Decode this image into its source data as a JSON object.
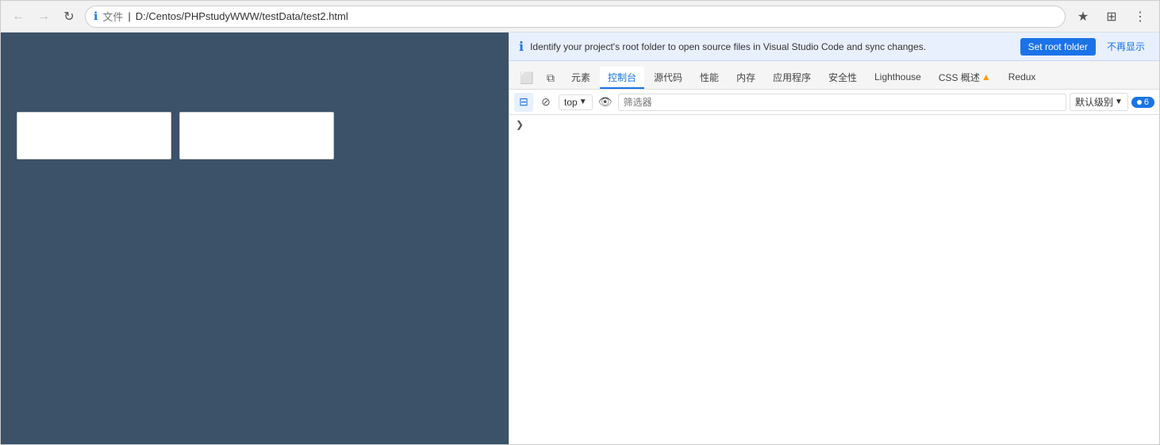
{
  "browser": {
    "back_btn": "←",
    "forward_btn": "→",
    "reload_btn": "↻",
    "file_label": "文件",
    "url": "D:/Centos/PHPstudyWWW/testData/test2.html",
    "star_icon": "★",
    "extensions_icon": "⊞",
    "menu_icon": "⋮"
  },
  "info_banner": {
    "text": "Identify your project's root folder to open source files in Visual Studio Code and sync changes.",
    "set_root_label": "Set root folder",
    "dismiss_label": "不再显示"
  },
  "devtools": {
    "tab_icons": [
      "📱",
      "⧉"
    ],
    "tabs": [
      {
        "id": "elements",
        "label": "元素",
        "active": false
      },
      {
        "id": "console",
        "label": "控制台",
        "active": true
      },
      {
        "id": "sources",
        "label": "源代码",
        "active": false
      },
      {
        "id": "performance",
        "label": "性能",
        "active": false
      },
      {
        "id": "memory",
        "label": "内存",
        "active": false
      },
      {
        "id": "application",
        "label": "应用程序",
        "active": false
      },
      {
        "id": "security",
        "label": "安全性",
        "active": false
      },
      {
        "id": "lighthouse",
        "label": "Lighthouse",
        "active": false
      },
      {
        "id": "css_overview",
        "label": "CSS 概述",
        "active": false
      },
      {
        "id": "redux",
        "label": "Redux",
        "active": false
      }
    ],
    "console": {
      "clear_icon": "🚫",
      "block_icon": "⊘",
      "context": "top",
      "context_arrow": "▼",
      "eye_icon": "👁",
      "filter_placeholder": "筛选器",
      "level_label": "默认级别",
      "level_arrow": "▼",
      "issue_count": "6",
      "expand_arrow": "❯"
    }
  },
  "page": {
    "bg_color": "#3b5268",
    "boxes": [
      {
        "id": "box1"
      },
      {
        "id": "box2"
      }
    ]
  }
}
